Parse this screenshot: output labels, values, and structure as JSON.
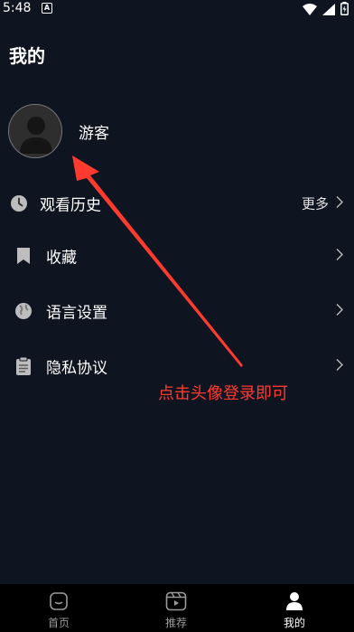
{
  "status_bar": {
    "time": "5:48",
    "notification_icon": "a-box-icon",
    "icons": [
      "wifi-icon",
      "signal-icon",
      "battery-icon"
    ]
  },
  "header": {
    "title": "我的"
  },
  "profile": {
    "avatar_icon": "user-avatar-icon",
    "name": "游客"
  },
  "menu": {
    "items": [
      {
        "icon": "clock-icon",
        "label": "观看历史",
        "trail_text": "更多"
      },
      {
        "icon": "bookmark-icon",
        "label": "收藏"
      },
      {
        "icon": "globe-icon",
        "label": "语言设置"
      },
      {
        "icon": "clipboard-icon",
        "label": "隐私协议"
      }
    ]
  },
  "annotation": {
    "text": "点击头像登录即可",
    "color": "#ff3b30"
  },
  "bottom_nav": {
    "items": [
      {
        "icon": "home-icon",
        "label": "首页"
      },
      {
        "icon": "video-icon",
        "label": "推荐"
      },
      {
        "icon": "person-icon",
        "label": "我的",
        "active": true
      }
    ]
  },
  "colors": {
    "background": "#0f1421",
    "nav_background": "#000000",
    "annotation": "#ff3b30"
  }
}
